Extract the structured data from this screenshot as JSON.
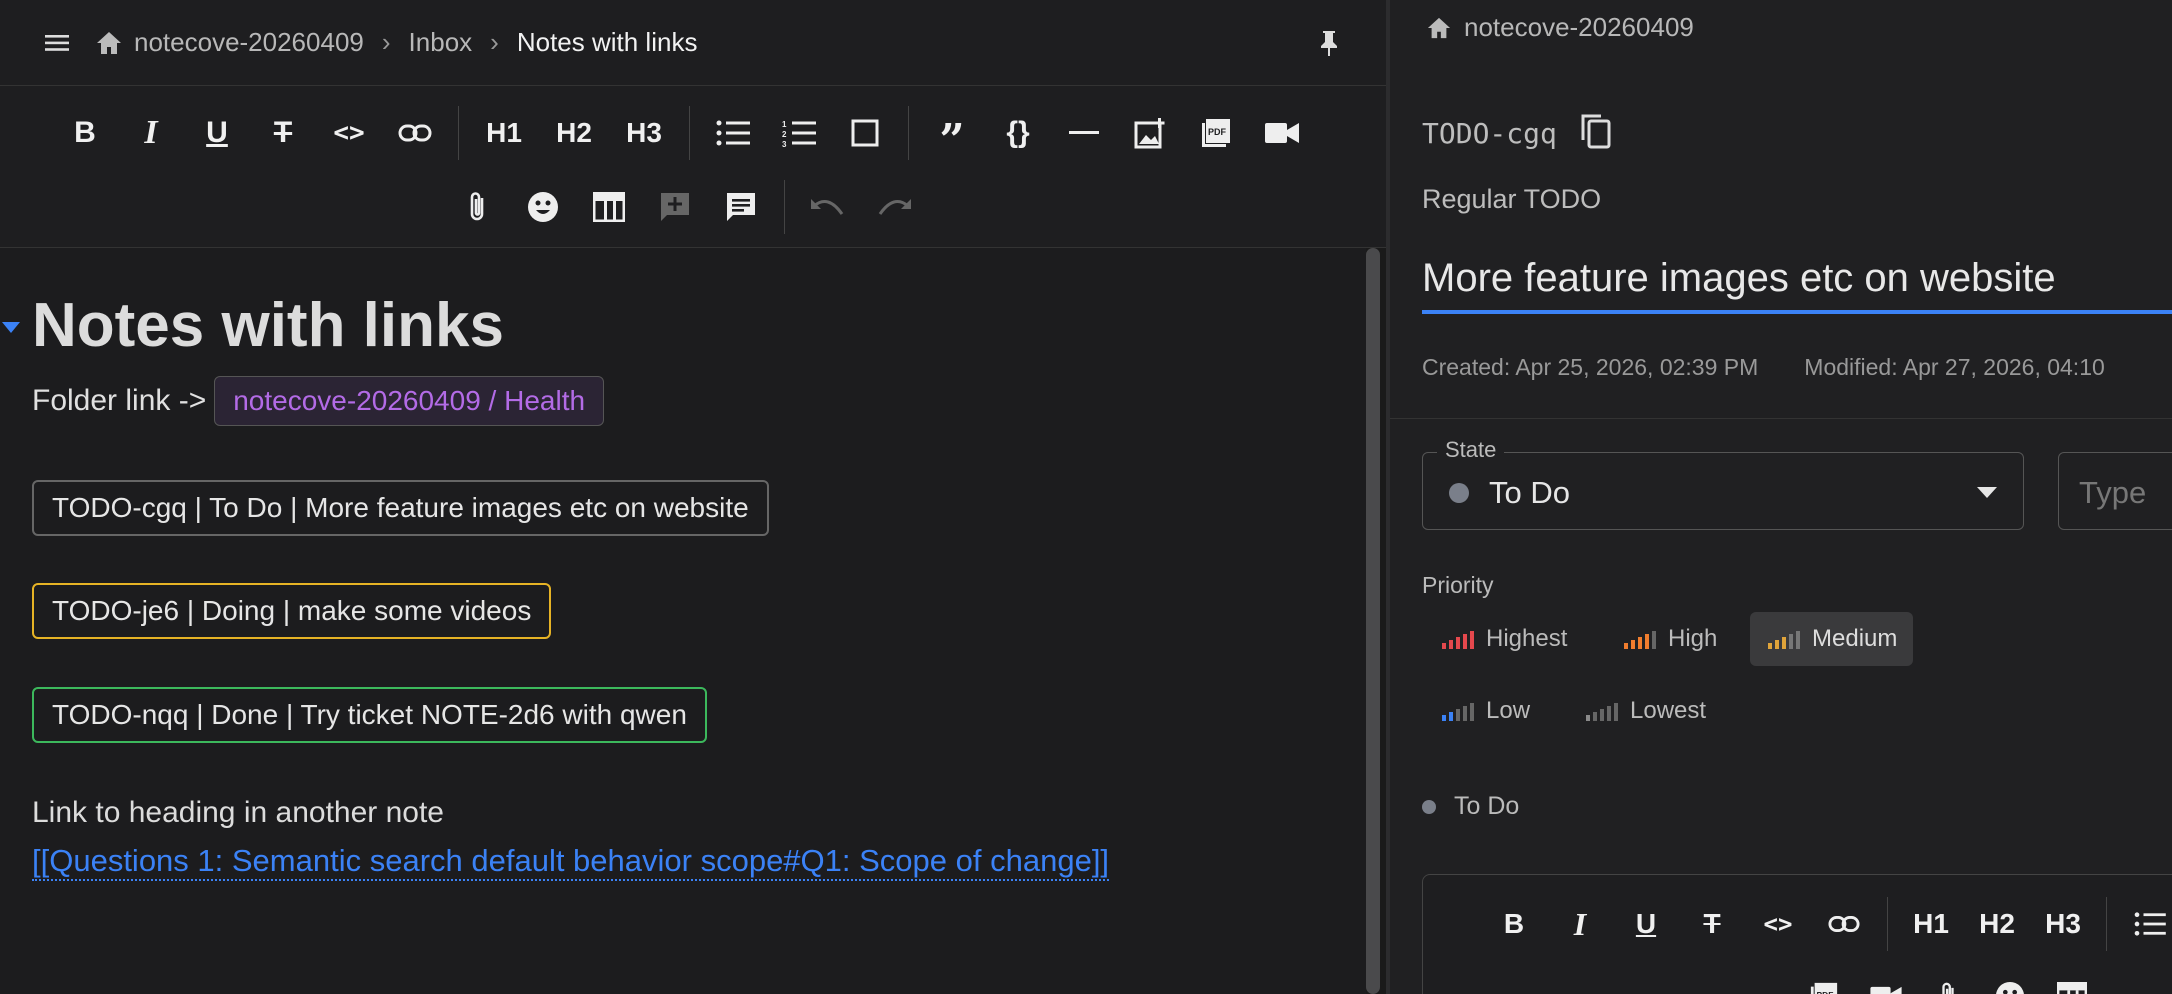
{
  "breadcrumb": {
    "items": [
      "notecove-20260409",
      "Inbox",
      "Notes with links"
    ],
    "separator": ">"
  },
  "toolbar": {
    "row1": [
      "bold",
      "italic",
      "underline",
      "strikethrough",
      "code",
      "link",
      "H1",
      "H2",
      "H3",
      "bullet-list",
      "numbered-list",
      "checkbox",
      "quote",
      "code-block",
      "horizontal-rule",
      "insert-image",
      "insert-pdf",
      "insert-video"
    ],
    "row2": [
      "attachment",
      "emoji",
      "table",
      "add-comment",
      "comments",
      "undo",
      "redo"
    ],
    "h1": "H1",
    "h2": "H2",
    "h3": "H3"
  },
  "document": {
    "title": "Notes with links",
    "folder_label": "Folder link ->",
    "folder_chip": "notecove-20260409 / Health",
    "todo_chips": [
      {
        "text": "TODO-cgq | To Do | More feature images etc on website",
        "status_color": "#666666"
      },
      {
        "text": "TODO-je6 | Doing | make some videos",
        "status_color": "#e6b325"
      },
      {
        "text": "TODO-nqq | Done | Try ticket NOTE-2d6 with qwen",
        "status_color": "#3cb85c"
      }
    ],
    "heading_link_label": "Link to heading in another note",
    "heading_link": "[[Questions 1: Semantic search default behavior scope#Q1: Scope of change]]"
  },
  "detail": {
    "breadcrumb": "notecove-20260409",
    "todo_id": "TODO-cgq",
    "todo_type": "Regular TODO",
    "title": "More feature images etc on website",
    "created": "Created: Apr 25, 2026, 02:39 PM",
    "modified": "Modified: Apr 27, 2026, 04:10",
    "state": {
      "label": "State",
      "value": "To Do",
      "color": "#7a7f8a"
    },
    "type_field": {
      "placeholder": "Type"
    },
    "priority": {
      "label": "Priority",
      "options": [
        {
          "label": "Highest",
          "color": "#e5484d"
        },
        {
          "label": "High",
          "color": "#f07d2e"
        },
        {
          "label": "Medium",
          "color": "#e0a43a",
          "selected": true
        },
        {
          "label": "Low",
          "color": "#3b82f6"
        },
        {
          "label": "Lowest",
          "color": "#8a8a8a"
        }
      ]
    },
    "status_text": "To Do",
    "editor_toolbar": {
      "h1": "H1",
      "h2": "H2",
      "h3": "H3"
    }
  },
  "colors": {
    "accent": "#3b82f6",
    "folder_chip_text": "#b36be6",
    "background": "#1c1c1e"
  }
}
